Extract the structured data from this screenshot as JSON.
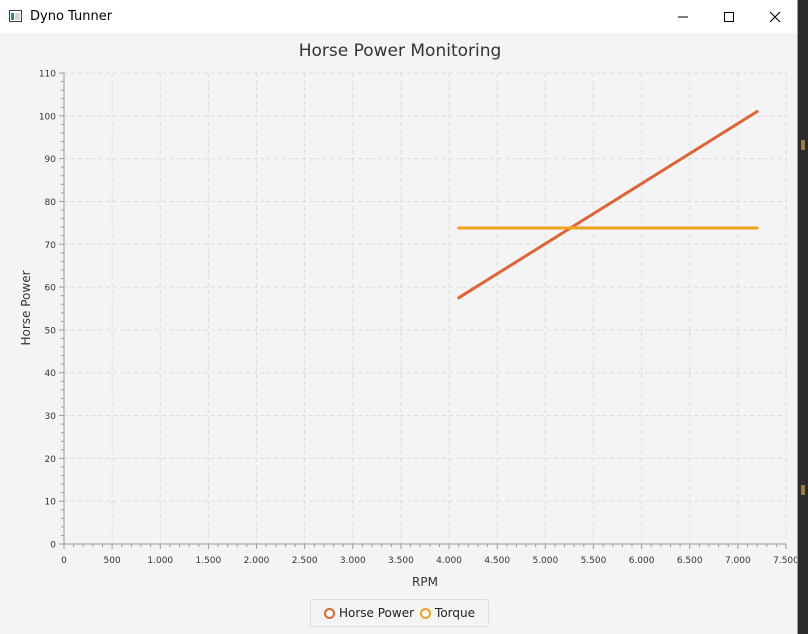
{
  "window": {
    "title": "Dyno Tunner",
    "icons": [
      "app-icon",
      "minimize-icon",
      "maximize-icon",
      "close-icon"
    ]
  },
  "colors": {
    "horse_power": "#e06434",
    "torque": "#f0a21c",
    "grid": "#dcdcdc",
    "axis": "#9a9a9a"
  },
  "chart_data": {
    "type": "line",
    "title": "Horse Power Monitoring",
    "xlabel": "RPM",
    "ylabel": "Horse Power",
    "xlim": [
      0,
      7500
    ],
    "ylim": [
      0,
      110
    ],
    "x_ticks": [
      "0",
      "500",
      "1.000",
      "1.500",
      "2.000",
      "2.500",
      "3.000",
      "3.500",
      "4.000",
      "4.500",
      "5.000",
      "5.500",
      "6.000",
      "6.500",
      "7.000",
      "7.500"
    ],
    "y_ticks": [
      "0",
      "10",
      "20",
      "30",
      "40",
      "50",
      "60",
      "70",
      "80",
      "90",
      "100",
      "110"
    ],
    "grid": true,
    "legend_position": "bottom-center",
    "series": [
      {
        "name": "Horse Power",
        "color": "#e06434",
        "points": [
          [
            4100,
            57.5
          ],
          [
            7200,
            101
          ]
        ]
      },
      {
        "name": "Torque",
        "color": "#f0a21c",
        "points": [
          [
            4100,
            73.8
          ],
          [
            7200,
            73.8
          ]
        ]
      }
    ]
  }
}
